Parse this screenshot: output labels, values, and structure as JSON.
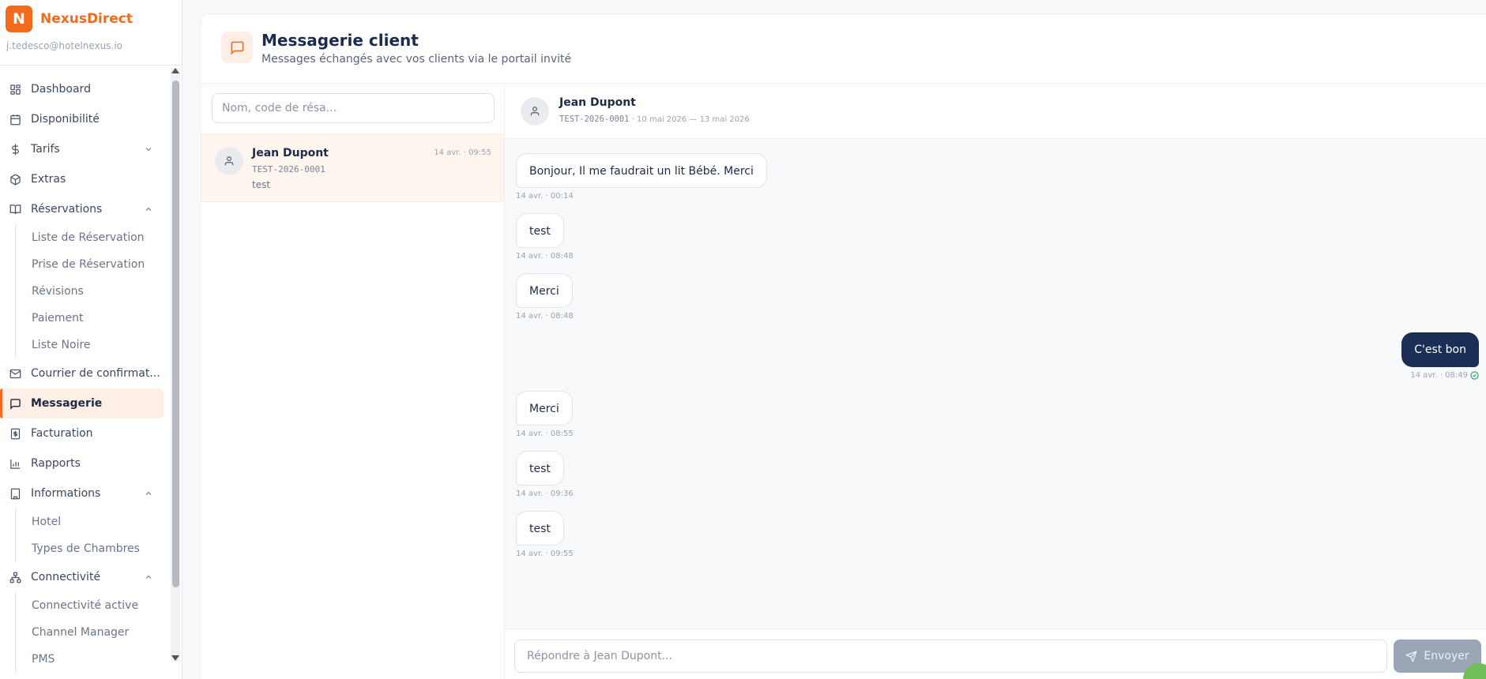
{
  "brand": {
    "logo_letter": "N",
    "name": "NexusDirect",
    "color": "#f26a1b"
  },
  "user": {
    "email": "j.tedesco@hotelnexus.io"
  },
  "sidebar": {
    "items": [
      {
        "label": "Dashboard",
        "icon": "dashboard-grid-icon"
      },
      {
        "label": "Disponibilité",
        "icon": "calendar-icon"
      },
      {
        "label": "Tarifs",
        "icon": "dollar-icon",
        "expand": "down"
      },
      {
        "label": "Extras",
        "icon": "package-icon"
      },
      {
        "label": "Réservations",
        "icon": "book-open-icon",
        "expand": "up",
        "children": [
          "Liste de Réservation",
          "Prise de Réservation",
          "Révisions",
          "Paiement",
          "Liste Noire"
        ]
      },
      {
        "label": "Courrier de confirmat...",
        "icon": "mail-icon"
      },
      {
        "label": "Messagerie",
        "icon": "message-square-icon",
        "active": true
      },
      {
        "label": "Facturation",
        "icon": "receipt-icon"
      },
      {
        "label": "Rapports",
        "icon": "bar-chart-icon"
      },
      {
        "label": "Informations",
        "icon": "building-icon",
        "expand": "up",
        "children": [
          "Hotel",
          "Types de Chambres"
        ]
      },
      {
        "label": "Connectivité",
        "icon": "network-icon",
        "expand": "up",
        "children": [
          "Connectivité active",
          "Channel Manager",
          "PMS"
        ]
      }
    ]
  },
  "header": {
    "icon": "message-square-icon",
    "title": "Messagerie client",
    "subtitle": "Messages échangés avec vos clients via le portail invité"
  },
  "conversations": {
    "search_placeholder": "Nom, code de résa...",
    "items": [
      {
        "name": "Jean Dupont",
        "time": "14 avr. · 09:55",
        "code": "TEST-2026-0001",
        "preview": "test"
      }
    ]
  },
  "chat": {
    "name": "Jean Dupont",
    "code": "TEST-2026-0001",
    "dates": "· 10 mai 2026 — 13 mai 2026",
    "messages": [
      {
        "text": "Bonjour, Il me faudrait un lit Bébé. Merci",
        "time": "14 avr. · 00:14",
        "dir": "in"
      },
      {
        "text": "test",
        "time": "14 avr. · 08:48",
        "dir": "in"
      },
      {
        "text": "Merci",
        "time": "14 avr. · 08:48",
        "dir": "in"
      },
      {
        "text": "C'est bon",
        "time": "14 avr. · 08:49",
        "dir": "out",
        "read": true
      },
      {
        "text": "Merci",
        "time": "14 avr. · 08:55",
        "dir": "in"
      },
      {
        "text": "test",
        "time": "14 avr. · 09:36",
        "dir": "in"
      },
      {
        "text": "test",
        "time": "14 avr. · 09:55",
        "dir": "in"
      }
    ],
    "reply_placeholder": "Répondre à Jean Dupont...",
    "send_label": "Envoyer"
  },
  "colors": {
    "accent": "#f26a1b",
    "navy": "#1b2f55",
    "read_check": "#22a06b"
  }
}
